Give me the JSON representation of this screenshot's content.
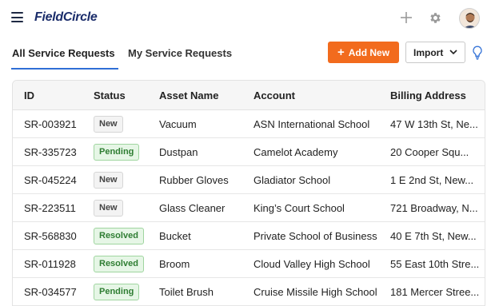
{
  "app": {
    "brand": "FieldCircle"
  },
  "header": {
    "icons": [
      "menu-icon",
      "plus-icon",
      "gear-icon",
      "avatar"
    ]
  },
  "tabs": [
    {
      "label": "All Service Requests",
      "active": true
    },
    {
      "label": "My Service Requests",
      "active": false
    }
  ],
  "actions": {
    "add_new_label": "Add New",
    "import_label": "Import",
    "accent_color": "#f26b1d"
  },
  "table": {
    "columns": [
      "ID",
      "Status",
      "Asset Name",
      "Account",
      "Billing Address"
    ],
    "rows": [
      {
        "id": "SR-003921",
        "status": "New",
        "asset": "Vacuum",
        "account": "ASN International School",
        "billing": "47 W 13th St, Ne..."
      },
      {
        "id": "SR-335723",
        "status": "Pending",
        "asset": "Dustpan",
        "account": "Camelot Academy",
        "billing": "20 Cooper Squ..."
      },
      {
        "id": "SR-045224",
        "status": "New",
        "asset": "Rubber Gloves",
        "account": "Gladiator School",
        "billing": "1 E 2nd St, New..."
      },
      {
        "id": "SR-223511",
        "status": "New",
        "asset": "Glass Cleaner",
        "account": "King’s Court School",
        "billing": "721 Broadway, N..."
      },
      {
        "id": "SR-568830",
        "status": "Resolved",
        "asset": "Bucket",
        "account": "Private School of Business",
        "billing": "40 E 7th St, New..."
      },
      {
        "id": "SR-011928",
        "status": "Resolved",
        "asset": "Broom",
        "account": "Cloud Valley High School",
        "billing": "55 East 10th Stre..."
      },
      {
        "id": "SR-034577",
        "status": "Pending",
        "asset": "Toilet Brush",
        "account": "Cruise Missile High School",
        "billing": "181 Mercer Stree..."
      }
    ]
  }
}
